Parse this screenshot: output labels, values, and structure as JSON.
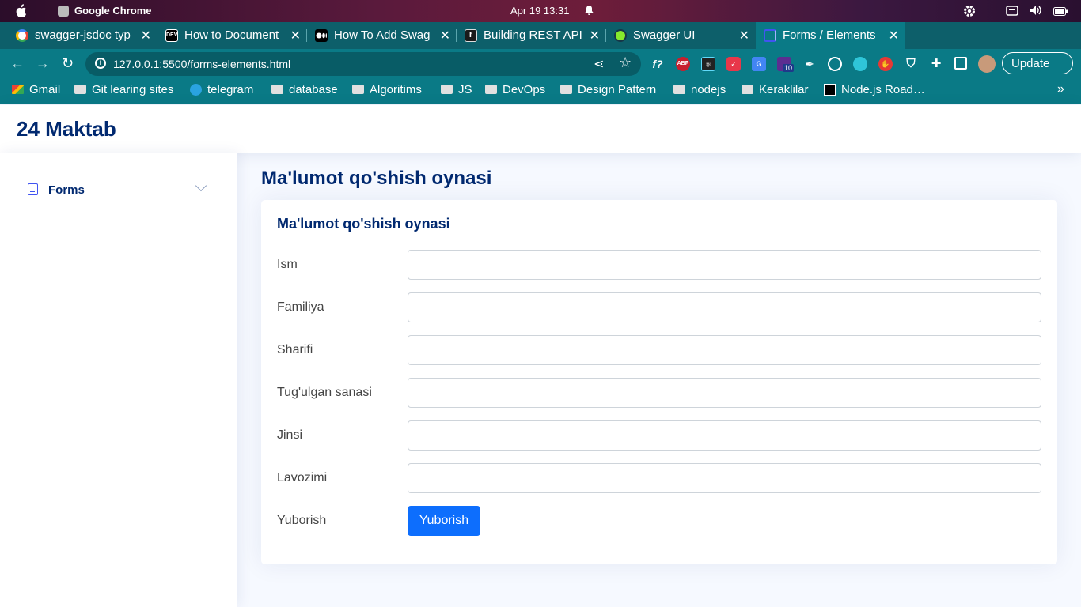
{
  "os_bar": {
    "app_name": "Google Chrome",
    "clock": "Apr 19  13:31"
  },
  "tabs": [
    {
      "title": "swagger-jsdoc typ",
      "close": "✕",
      "favicon_color": "#ffffff"
    },
    {
      "title": "How to Document",
      "close": "✕",
      "favicon_color": "#000000"
    },
    {
      "title": "How To Add Swag",
      "close": "✕",
      "favicon_color": "#000000"
    },
    {
      "title": "Building REST API",
      "close": "✕",
      "favicon_color": "#1a1a1a"
    },
    {
      "title": "Swagger UI",
      "close": "✕",
      "favicon_color": "#85ea2d"
    },
    {
      "title": "Forms / Elements",
      "close": "✕",
      "favicon_color": "#4154f1"
    }
  ],
  "toolbar": {
    "url": "127.0.0.1:5500/forms-elements.html",
    "update_label": "Update",
    "ext_badge": "10"
  },
  "bookmarks": [
    {
      "label": "Gmail",
      "icon": "gmail-icon"
    },
    {
      "label": "Git learing sites",
      "icon": "folder-icon"
    },
    {
      "label": "telegram",
      "icon": "telegram-icon"
    },
    {
      "label": "database",
      "icon": "folder-icon"
    },
    {
      "label": "Algoritims",
      "icon": "folder-icon"
    },
    {
      "label": "JS",
      "icon": "folder-icon"
    },
    {
      "label": "DevOps",
      "icon": "folder-icon"
    },
    {
      "label": "Design Pattern",
      "icon": "folder-icon"
    },
    {
      "label": "nodejs",
      "icon": "folder-icon"
    },
    {
      "label": "Keraklilar",
      "icon": "folder-icon"
    },
    {
      "label": "Node.js Road…",
      "icon": "roadmap-icon"
    }
  ],
  "header": {
    "logo": "24 Maktab"
  },
  "sidebar": {
    "items": [
      {
        "label": "Forms"
      }
    ]
  },
  "main": {
    "page_title": "Ma'lumot qo'shish oynasi",
    "card_title": "Ma'lumot qo'shish oynasi",
    "fields": [
      {
        "label": "Ism",
        "value": ""
      },
      {
        "label": "Familiya",
        "value": ""
      },
      {
        "label": "Sharifi",
        "value": ""
      },
      {
        "label": "Tug'ulgan sanasi",
        "value": ""
      },
      {
        "label": "Jinsi",
        "value": ""
      },
      {
        "label": "Lavozimi",
        "value": ""
      }
    ],
    "submit_row_label": "Yuborish",
    "submit_button": "Yuborish"
  },
  "colors": {
    "accent": "#4154f1",
    "title": "#012970",
    "button": "#0d6efd",
    "browser_frame": "#0a7a86"
  }
}
